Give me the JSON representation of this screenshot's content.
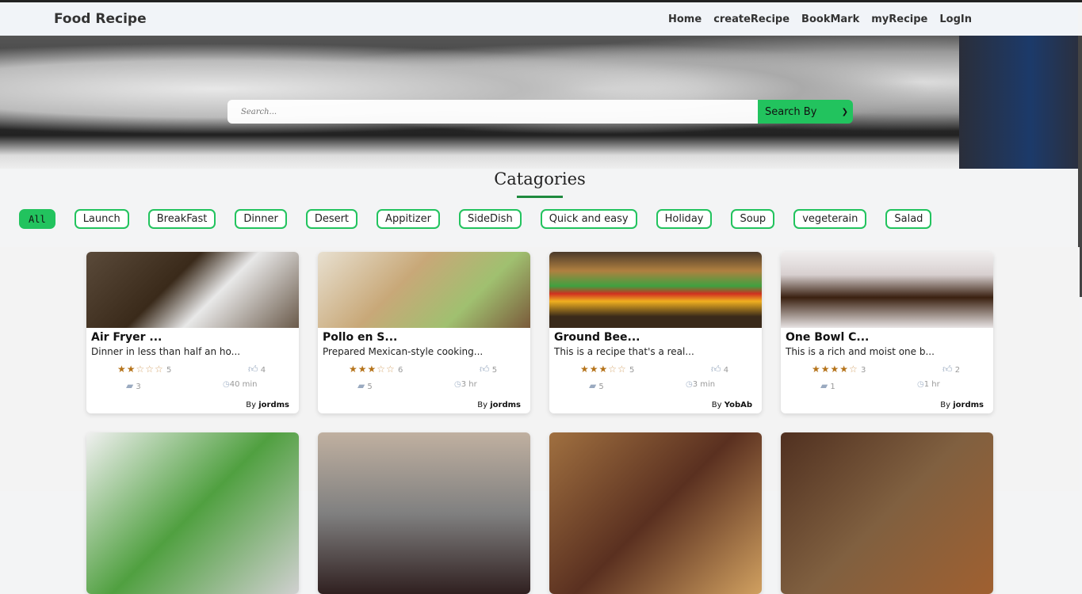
{
  "nav": {
    "brand": "Food Recipe",
    "links": [
      "Home",
      "createRecipe",
      "BookMark",
      "myRecipe",
      "LogIn"
    ]
  },
  "search": {
    "placeholder": "Search...",
    "select_label": "Search By"
  },
  "categories": {
    "title": "Catagories",
    "items": [
      "All",
      "Launch",
      "BreakFast",
      "Dinner",
      "Desert",
      "Appitizer",
      "SideDish",
      "Quick and easy",
      "Holiday",
      "Soup",
      "vegeterain",
      "Salad"
    ],
    "active": "All"
  },
  "colors": {
    "accent": "#22c35e",
    "star": "#b5731a"
  },
  "recipes": [
    {
      "title": "Air Fryer ...",
      "desc": "Dinner in less than half an ho...",
      "rating": 2,
      "ratings_count": "5",
      "likes": "4",
      "comments": "3",
      "time": "40 min",
      "by": "By",
      "author": "jordms"
    },
    {
      "title": "Pollo en S...",
      "desc": "Prepared Mexican-style cooking...",
      "rating": 3,
      "ratings_count": "6",
      "likes": "5",
      "comments": "5",
      "time": "3 hr",
      "by": "By",
      "author": "jordms"
    },
    {
      "title": "Ground Bee...",
      "desc": "This is a recipe that's a real...",
      "rating": 3,
      "ratings_count": "5",
      "likes": "4",
      "comments": "5",
      "time": "3 min",
      "by": "By",
      "author": "YobAb"
    },
    {
      "title": "One Bowl C...",
      "desc": "This is a rich and moist one b...",
      "rating": 4,
      "ratings_count": "3",
      "likes": "2",
      "comments": "1",
      "time": "1 hr",
      "by": "By",
      "author": "jordms"
    }
  ]
}
